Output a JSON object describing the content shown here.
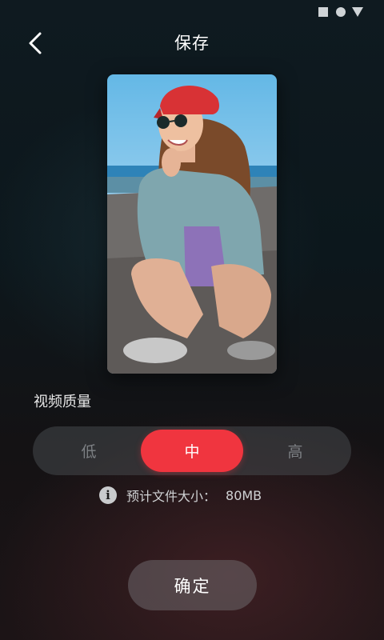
{
  "status_bar": {
    "icons": [
      "square-icon",
      "circle-icon",
      "triangle-icon"
    ]
  },
  "header": {
    "back_icon": "chevron-left-icon",
    "title": "保存"
  },
  "preview": {
    "description_icon": "photo-preview"
  },
  "quality": {
    "label": "视频质量",
    "options": [
      {
        "label": "低",
        "selected": false
      },
      {
        "label": "中",
        "selected": true
      },
      {
        "label": "高",
        "selected": false
      }
    ],
    "selected_color": "#f0353f"
  },
  "estimate": {
    "icon": "info-icon",
    "icon_glyph": "i",
    "label": "预计文件大小：",
    "value": "80MB"
  },
  "confirm": {
    "label": "确定"
  }
}
